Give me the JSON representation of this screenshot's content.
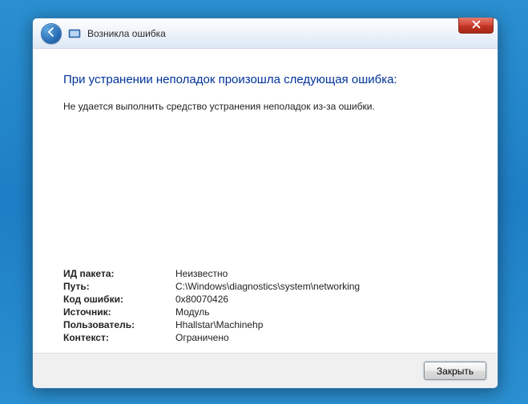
{
  "window": {
    "title": "Возникла ошибка"
  },
  "content": {
    "heading": "При устранении неполадок произошла следующая ошибка:",
    "subtext": "Не удается выполнить средство устранения неполадок из-за ошибки."
  },
  "details": {
    "rows": [
      {
        "label": "ИД пакета:",
        "value": "Неизвестно"
      },
      {
        "label": "Путь:",
        "value": "C:\\Windows\\diagnostics\\system\\networking"
      },
      {
        "label": "Код ошибки:",
        "value": "0x80070426"
      },
      {
        "label": "Источник:",
        "value": "Модуль"
      },
      {
        "label": "Пользователь:",
        "value": "Hhallstar\\Machinehp"
      },
      {
        "label": "Контекст:",
        "value": "Ограничено"
      }
    ]
  },
  "footer": {
    "close_label": "Закрыть"
  }
}
